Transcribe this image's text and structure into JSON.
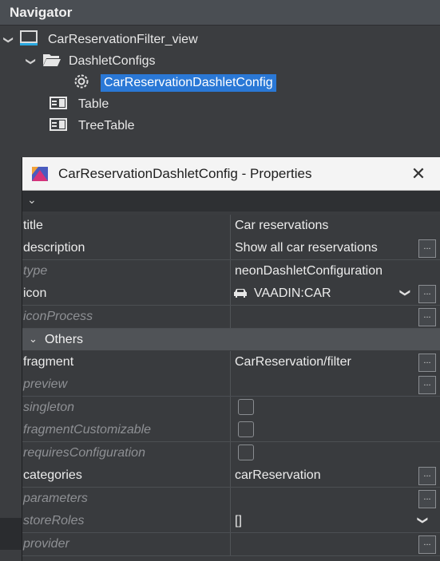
{
  "navigator": {
    "title": "Navigator",
    "items": [
      {
        "label": "CarReservationFilter_view",
        "icon": "view-icon"
      },
      {
        "label": "DashletConfigs",
        "icon": "folder-open-icon"
      },
      {
        "label": "CarReservationDashletConfig",
        "icon": "gear-icon",
        "selected": true
      },
      {
        "label": "Table",
        "icon": "table-icon"
      },
      {
        "label": "TreeTable",
        "icon": "table-icon"
      }
    ]
  },
  "properties": {
    "window_title": "CarReservationDashletConfig - Properties",
    "rows": [
      {
        "key": "title",
        "value": "Car reservations"
      },
      {
        "key": "description",
        "value": "Show all car reservations"
      },
      {
        "key": "type",
        "value": "neonDashletConfiguration"
      },
      {
        "key": "icon",
        "value": "VAADIN:CAR"
      },
      {
        "key": "iconProcess",
        "value": ""
      }
    ],
    "section_label": "Others",
    "others": [
      {
        "key": "fragment",
        "value": "CarReservation/filter"
      },
      {
        "key": "preview",
        "value": ""
      },
      {
        "key": "singleton",
        "value": ""
      },
      {
        "key": "fragmentCustomizable",
        "value": ""
      },
      {
        "key": "requiresConfiguration",
        "value": ""
      },
      {
        "key": "categories",
        "value": "carReservation"
      },
      {
        "key": "parameters",
        "value": ""
      },
      {
        "key": "storeRoles",
        "value": "[]"
      },
      {
        "key": "provider",
        "value": ""
      }
    ],
    "dots_label": "..."
  },
  "colors": {
    "selection": "#2a78d6",
    "background": "#3b3d40"
  }
}
